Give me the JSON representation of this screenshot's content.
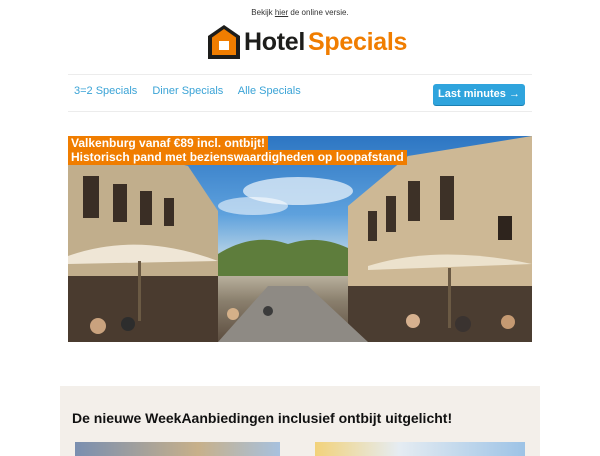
{
  "preheader": {
    "before": "Bekijk ",
    "link": "hier",
    "after": " de online versie."
  },
  "logo": {
    "word1": "Hotel",
    "word2": "Specials",
    "icon": "house-logo-icon"
  },
  "nav": {
    "items": [
      "3=2 Specials",
      "Diner Specials",
      "Alle Specials"
    ],
    "cta": "Last minutes →"
  },
  "hero": {
    "line1": "Valkenburg vanaf €89 incl. ontbijt!",
    "line2": "Historisch pand met bezienswaardigheden op loopafstand"
  },
  "weekdeals": {
    "heading": "De nieuwe WeekAanbiedingen inclusief ontbijt uitgelicht!"
  },
  "colors": {
    "orange": "#f07d00",
    "blue": "#2fa4dd",
    "link": "#3aa3d6",
    "panel": "#f3efea"
  }
}
